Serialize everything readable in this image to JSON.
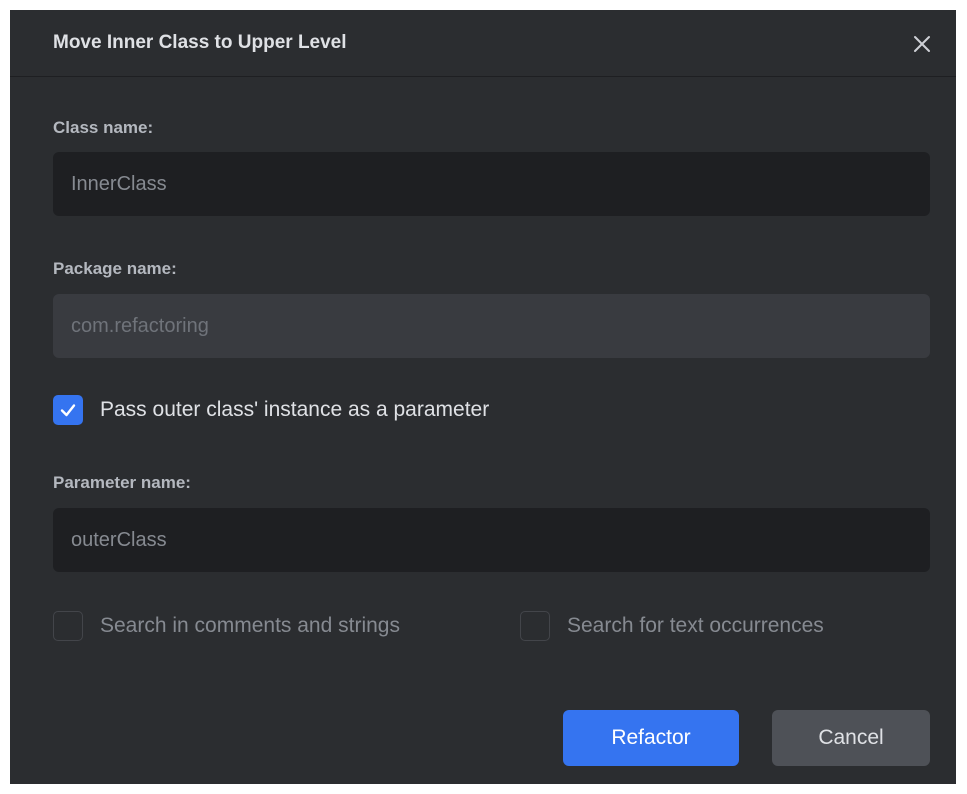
{
  "dialog": {
    "title": "Move Inner Class to Upper Level",
    "close_icon": "close-icon"
  },
  "class_name": {
    "label": "Class name:",
    "value": "InnerClass"
  },
  "package_name": {
    "label": "Package name:",
    "value": "com.refactoring"
  },
  "pass_instance": {
    "label": "Pass outer class' instance as a parameter",
    "checked": true
  },
  "parameter_name": {
    "label": "Parameter name:",
    "value": "outerClass"
  },
  "search_comments": {
    "label": "Search in comments and strings",
    "checked": false
  },
  "search_text": {
    "label": "Search for text occurrences",
    "checked": false
  },
  "buttons": {
    "refactor": "Refactor",
    "cancel": "Cancel"
  },
  "colors": {
    "background": "#2b2d30",
    "input_background": "#1e1f22",
    "accent": "#3574f0"
  }
}
